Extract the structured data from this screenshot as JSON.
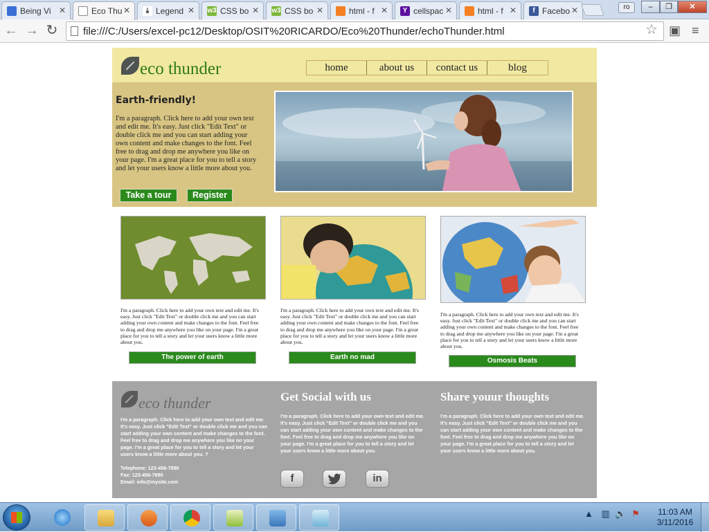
{
  "browser": {
    "tabs": [
      {
        "title": "Being Vi",
        "favicon_color": "#3b6fd6",
        "glyph": "",
        "active": false
      },
      {
        "title": "Eco Thu",
        "favicon_color": "#ffffff",
        "glyph": "",
        "active": true
      },
      {
        "title": "Legend",
        "favicon_color": "#222222",
        "glyph": "",
        "active": false
      },
      {
        "title": "CSS bo",
        "favicon_color": "#7cb83a",
        "glyph": "w3",
        "active": false
      },
      {
        "title": "CSS bo",
        "favicon_color": "#7cb83a",
        "glyph": "w3",
        "active": false
      },
      {
        "title": "html - f",
        "favicon_color": "#f48024",
        "glyph": "",
        "active": false
      },
      {
        "title": "cellspac",
        "favicon_color": "#5b0f9e",
        "glyph": "Y",
        "active": false
      },
      {
        "title": "html - f",
        "favicon_color": "#f48024",
        "glyph": "",
        "active": false
      },
      {
        "title": "Facebo",
        "favicon_color": "#3b5998",
        "glyph": "f",
        "active": false
      }
    ],
    "user_badge": "ro",
    "url": "file:///C:/Users/excel-pc12/Desktop/OSIT%20RICARDO/Eco%20Thunder/echoThunder.html",
    "window_buttons": {
      "minimize": "–",
      "restore": "❐",
      "close": "✕"
    }
  },
  "site": {
    "logo_text": "eco thunder",
    "nav": [
      "home",
      "about us",
      "contact us",
      "blog"
    ],
    "hero": {
      "heading": "Earth-friendly!",
      "paragraph": "I'm a paragraph. Click here to add your own text and edit me. It's easy. Just click \"Edit Text\" or double click me and you can start adding your own content and make changes to the font. Feel free to drag and drop me anywhere you like on your page. I'm a great place for you to tell a story and let your users know a little more about you.",
      "tour_button": "Take a tour",
      "register_button": "Register"
    },
    "columns": [
      {
        "paragraph": "I'm a paragraph. Click here to add your own text and edit me. It's easy. Just click \"Edit Text\" or double click me and you can start adding your own content and make changes to the font. Feel free to drag and drop me anywhere you like on your page. I'm a great place for you to tell a story and let your users know a little more about you.",
        "button": "The power of earth"
      },
      {
        "paragraph": "I'm a paragraph. Click here to add your own text and edit me. It's easy. Just click \"Edit Text\" or double click me and you can start adding your own content and make changes to the font. Feel free to drag and drop me anywhere you like on your page. I'm a great place for you to tell a story and let your users know a little more about you.",
        "button": "Earth no mad"
      },
      {
        "paragraph": "I'm a paragraph. Click here to add your own text and edit me. It's easy. Just click \"Edit Text\" or double click me and you can start adding your own content and make changes to the font. Feel free to drag and drop me anywhere you like on your page. I'm a great place for you to tell a story and let your users know a little more about you.",
        "button": "Osmosis Beats"
      }
    ],
    "footer": {
      "logo_text": "eco thunder",
      "about": "I'm a paragraph. Click here to add your own text and edit me. It's easy. Just click \"Edit Text\" or double click me and you can start adding your own content and make changes to the font. Feel free to drag and drop me anywhere you like on your page. I'm a great place for you to tell a story and let your users know a little more about you. ?",
      "telephone": "Telephone: 123-456-7890",
      "fax": "Fax: 123-456-7890",
      "email": "Email: info@mysite.com",
      "social_heading": "Get Social with us",
      "social_text": "I'm a paragraph. Click here to add your own text and edit me. It's easy. Just click \"Edit Text\" or double click me and you can start adding your own content and make changes to the font. Feel free to drag and drop me anywhere you like on your page. I'm a great place for you to tell a story and let your users know a little more about you.",
      "social_icons": [
        "f",
        "t",
        "in"
      ],
      "share_heading": "Share youur thoughts",
      "share_text": "I'm a paragraph. Click here to add your own text and edit me. It's easy. Just click \"Edit Text\" or double click me and you can start adding your own content and make changes to the font. Feel free to drag and drop me anywhere you like on your page. I'm a great place for you to tell a story and let your users know a little more about you."
    },
    "colors": {
      "header": "#f1e8a2",
      "hero": "#d8c583",
      "button": "#2a8a1c",
      "footer": "#a6a6a6",
      "logo": "#2f7a12"
    }
  },
  "taskbar": {
    "apps": [
      "ie-icon",
      "explorer-icon",
      "media-player-icon",
      "chrome-icon",
      "notepad-plus-icon",
      "photo-viewer-icon",
      "notes-icon"
    ],
    "time": "11:03 AM",
    "date": "3/11/2016"
  }
}
